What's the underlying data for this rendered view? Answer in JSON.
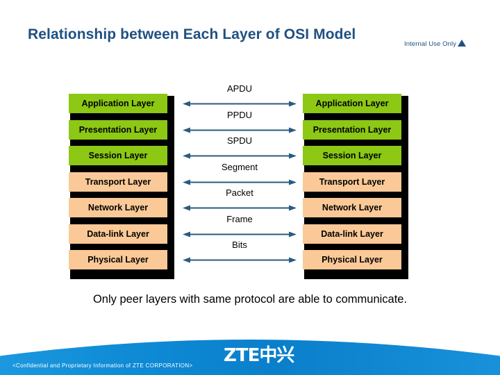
{
  "slide": {
    "title": "Relationship between Each Layer of OSI Model",
    "classification": "Internal Use Only",
    "classification_icon": "triangle-up-icon",
    "title_color": "#1F5082",
    "background_color": "#FFFFFF"
  },
  "diagram": {
    "left_stack": {
      "name": "OSI layer stack (host A)",
      "layers": [
        {
          "label": "Application Layer",
          "color": "#8CC814"
        },
        {
          "label": "Presentation Layer",
          "color": "#8CC814"
        },
        {
          "label": "Session Layer",
          "color": "#8CC814"
        },
        {
          "label": "Transport Layer",
          "color": "#FBC997"
        },
        {
          "label": "Network Layer",
          "color": "#FBC997"
        },
        {
          "label": "Data-link Layer",
          "color": "#FBC997"
        },
        {
          "label": "Physical Layer",
          "color": "#FBC997"
        }
      ]
    },
    "right_stack": {
      "name": "OSI layer stack (host B)",
      "layers": [
        {
          "label": "Application Layer",
          "color": "#8CC814"
        },
        {
          "label": "Presentation Layer",
          "color": "#8CC814"
        },
        {
          "label": "Session Layer",
          "color": "#8CC814"
        },
        {
          "label": "Transport Layer",
          "color": "#FBC997"
        },
        {
          "label": "Network Layer",
          "color": "#FBC997"
        },
        {
          "label": "Data-link Layer",
          "color": "#FBC997"
        },
        {
          "label": "Physical Layer",
          "color": "#FBC997"
        }
      ]
    },
    "peer_arrows": {
      "color": "#2A5B80",
      "style": "double-headed",
      "labels": [
        "APDU",
        "PPDU",
        "SPDU",
        "Segment",
        "Packet",
        "Frame",
        "Bits"
      ]
    }
  },
  "caption": "Only peer layers with same protocol are able to communicate.",
  "footer": {
    "confidentiality": "<Confidential and Proprietary Information of ZTE CORPORATION>",
    "logo_text": "ZTE中兴",
    "band_color": "#0A8AD4"
  }
}
